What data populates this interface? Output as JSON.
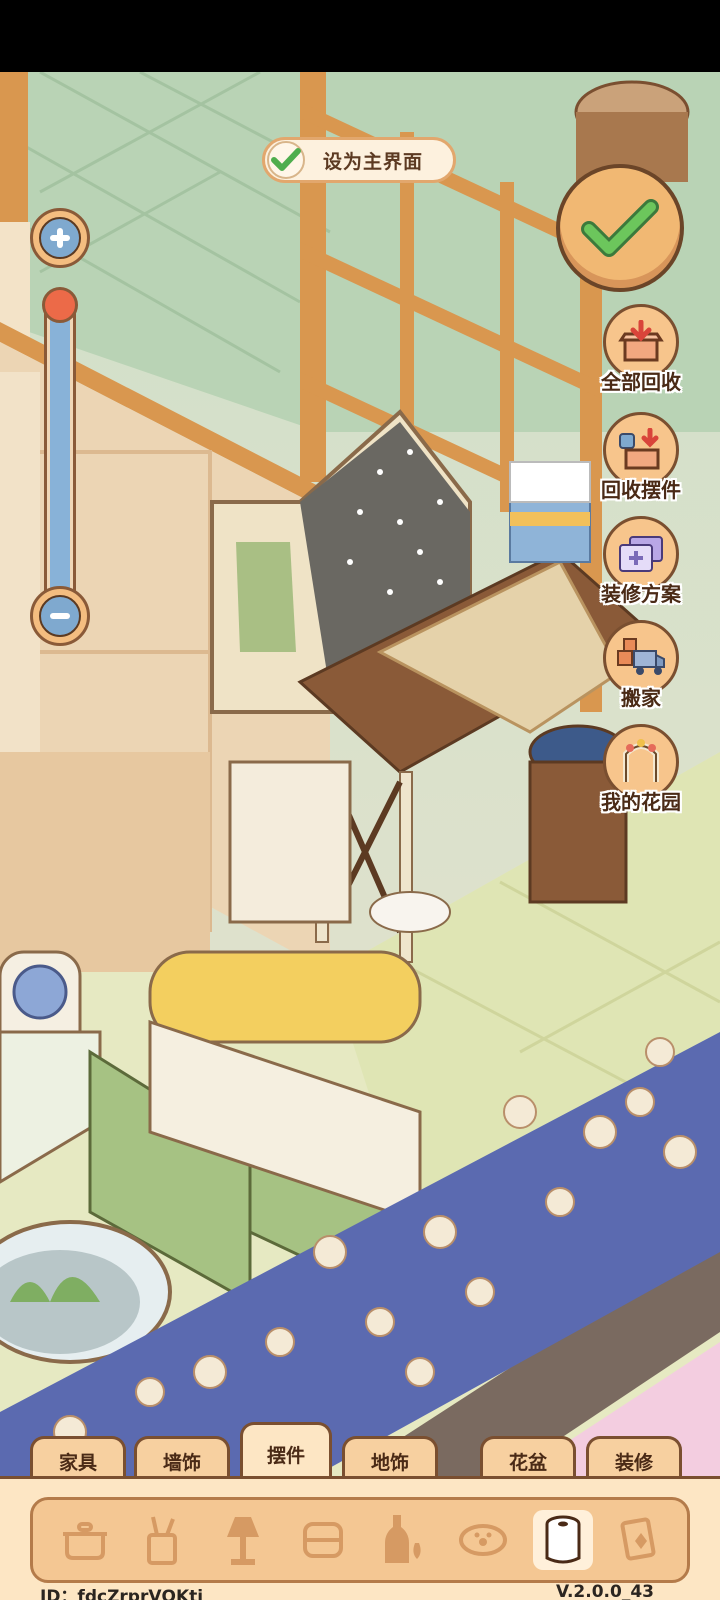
{
  "set_main": {
    "label": "设为主界面",
    "checked": true
  },
  "zoom": {
    "level_fraction": 0.98
  },
  "side_actions": [
    {
      "label": "全部回收",
      "icon": "box-down-arrow-icon"
    },
    {
      "label": "回收摆件",
      "icon": "cup-box-recycle-icon"
    },
    {
      "label": "装修方案",
      "icon": "plan-cards-icon"
    },
    {
      "label": "搬家",
      "icon": "moving-truck-icon"
    },
    {
      "label": "我的花园",
      "icon": "garden-arch-icon"
    }
  ],
  "tabs": [
    {
      "label": "家具"
    },
    {
      "label": "墙饰"
    },
    {
      "label": "摆件",
      "active": true
    },
    {
      "label": "地饰"
    },
    {
      "label": "花盆"
    },
    {
      "label": "装修"
    }
  ],
  "categories": [
    "pot-icon",
    "tools-cup-icon",
    "lamp-icon",
    "cushion-icon",
    "bottle-icon",
    "pet-bowl-icon",
    "paper-roll-icon",
    "cards-icon"
  ],
  "footer": {
    "id": "ID：fdcZrprVQKtj",
    "version": "V.2.0.0_43"
  },
  "colors": {
    "accent": "#f1b873",
    "outline": "#6b4528",
    "check": "#4fae4e"
  }
}
